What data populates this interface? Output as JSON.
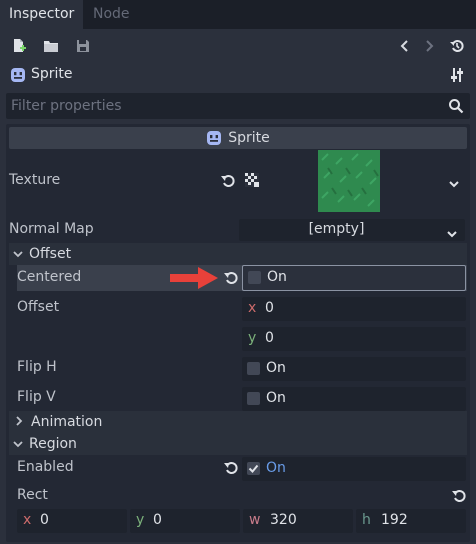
{
  "tabs": [
    {
      "label": "Inspector",
      "active": true
    },
    {
      "label": "Node",
      "active": false
    }
  ],
  "toolbar": {
    "icons": [
      "new-resource-icon",
      "open-folder-icon",
      "save-icon",
      "history-back-icon",
      "history-forward-icon",
      "object-history-icon"
    ]
  },
  "object": {
    "name": "Sprite",
    "icon": "sprite-icon"
  },
  "search": {
    "placeholder": "Filter properties"
  },
  "inspector_header": {
    "title": "Sprite"
  },
  "properties": {
    "texture": {
      "label": "Texture"
    },
    "normal_map": {
      "label": "Normal Map",
      "value": "[empty]"
    },
    "offset_section": {
      "label": "Offset"
    },
    "centered": {
      "label": "Centered",
      "value": "On",
      "checked": false
    },
    "offset": {
      "label": "Offset",
      "x_axis": "x",
      "y_axis": "y",
      "x": "0",
      "y": "0"
    },
    "flip_h": {
      "label": "Flip H",
      "value": "On",
      "checked": false
    },
    "flip_v": {
      "label": "Flip V",
      "value": "On",
      "checked": false
    },
    "animation_section": {
      "label": "Animation"
    },
    "region_section": {
      "label": "Region"
    },
    "enabled": {
      "label": "Enabled",
      "value": "On",
      "checked": true
    },
    "rect": {
      "label": "Rect",
      "x_axis": "x",
      "y_axis": "y",
      "w_axis": "w",
      "h_axis": "h",
      "x": "0",
      "y": "0",
      "w": "320",
      "h": "192"
    }
  },
  "colors": {
    "accent": "#699ce8",
    "texture_green": "#2f8a4f",
    "annotation_arrow": "#e8413a"
  }
}
